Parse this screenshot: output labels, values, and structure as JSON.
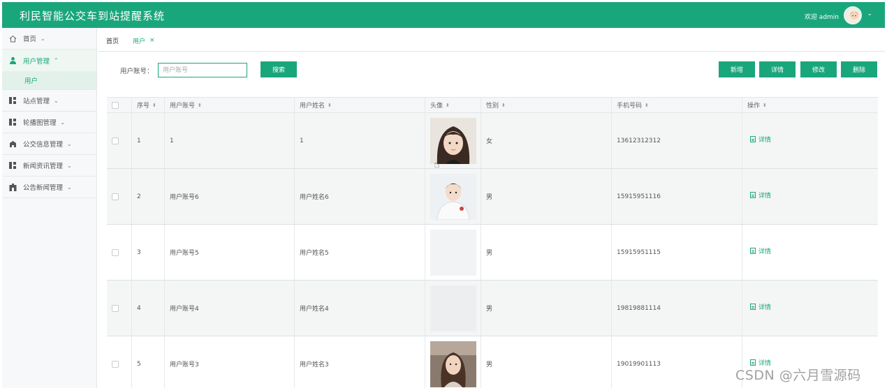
{
  "app": {
    "title": "利民智能公交车到站提醒系统",
    "welcome": "欢迎 admin"
  },
  "sidebar": {
    "items": [
      {
        "label": "首页",
        "icon": "home-icon"
      },
      {
        "label": "用户管理",
        "icon": "user-icon"
      },
      {
        "label": "站点管理",
        "icon": "grid-icon"
      },
      {
        "label": "轮播图管理",
        "icon": "grid-icon"
      },
      {
        "label": "公交信息管理",
        "icon": "bus-icon"
      },
      {
        "label": "新闻资讯管理",
        "icon": "grid-icon"
      },
      {
        "label": "公告新闻管理",
        "icon": "building-icon"
      }
    ],
    "sub_item": "用户"
  },
  "tabs": {
    "home": "首页",
    "user": "用户"
  },
  "search": {
    "label": "用户账号：",
    "placeholder": "用户账号",
    "button": "搜索"
  },
  "actions": {
    "add": "新增",
    "detail": "详情",
    "edit": "修改",
    "delete": "删除"
  },
  "table": {
    "headers": [
      "序号",
      "用户账号",
      "用户姓名",
      "头像",
      "性别",
      "手机号码",
      "操作"
    ],
    "rows": [
      {
        "no": "1",
        "account": "1",
        "name": "1",
        "avatar": "girl-dark-hair",
        "gender": "女",
        "phone": "13612312312",
        "action": "详情"
      },
      {
        "no": "2",
        "account": "用户账号6",
        "name": "用户姓名6",
        "avatar": "boy-white-shirt",
        "gender": "男",
        "phone": "15915951116",
        "action": "详情"
      },
      {
        "no": "3",
        "account": "用户账号5",
        "name": "用户姓名5",
        "avatar": "blank",
        "gender": "男",
        "phone": "15915951115",
        "action": "详情"
      },
      {
        "no": "4",
        "account": "用户账号4",
        "name": "用户姓名4",
        "avatar": "blank",
        "gender": "男",
        "phone": "19819881114",
        "action": "详情"
      },
      {
        "no": "5",
        "account": "用户账号3",
        "name": "用户姓名3",
        "avatar": "girl-street",
        "gender": "男",
        "phone": "19019901113",
        "action": "详情"
      }
    ]
  },
  "watermark": "CSDN @六月雪源码"
}
